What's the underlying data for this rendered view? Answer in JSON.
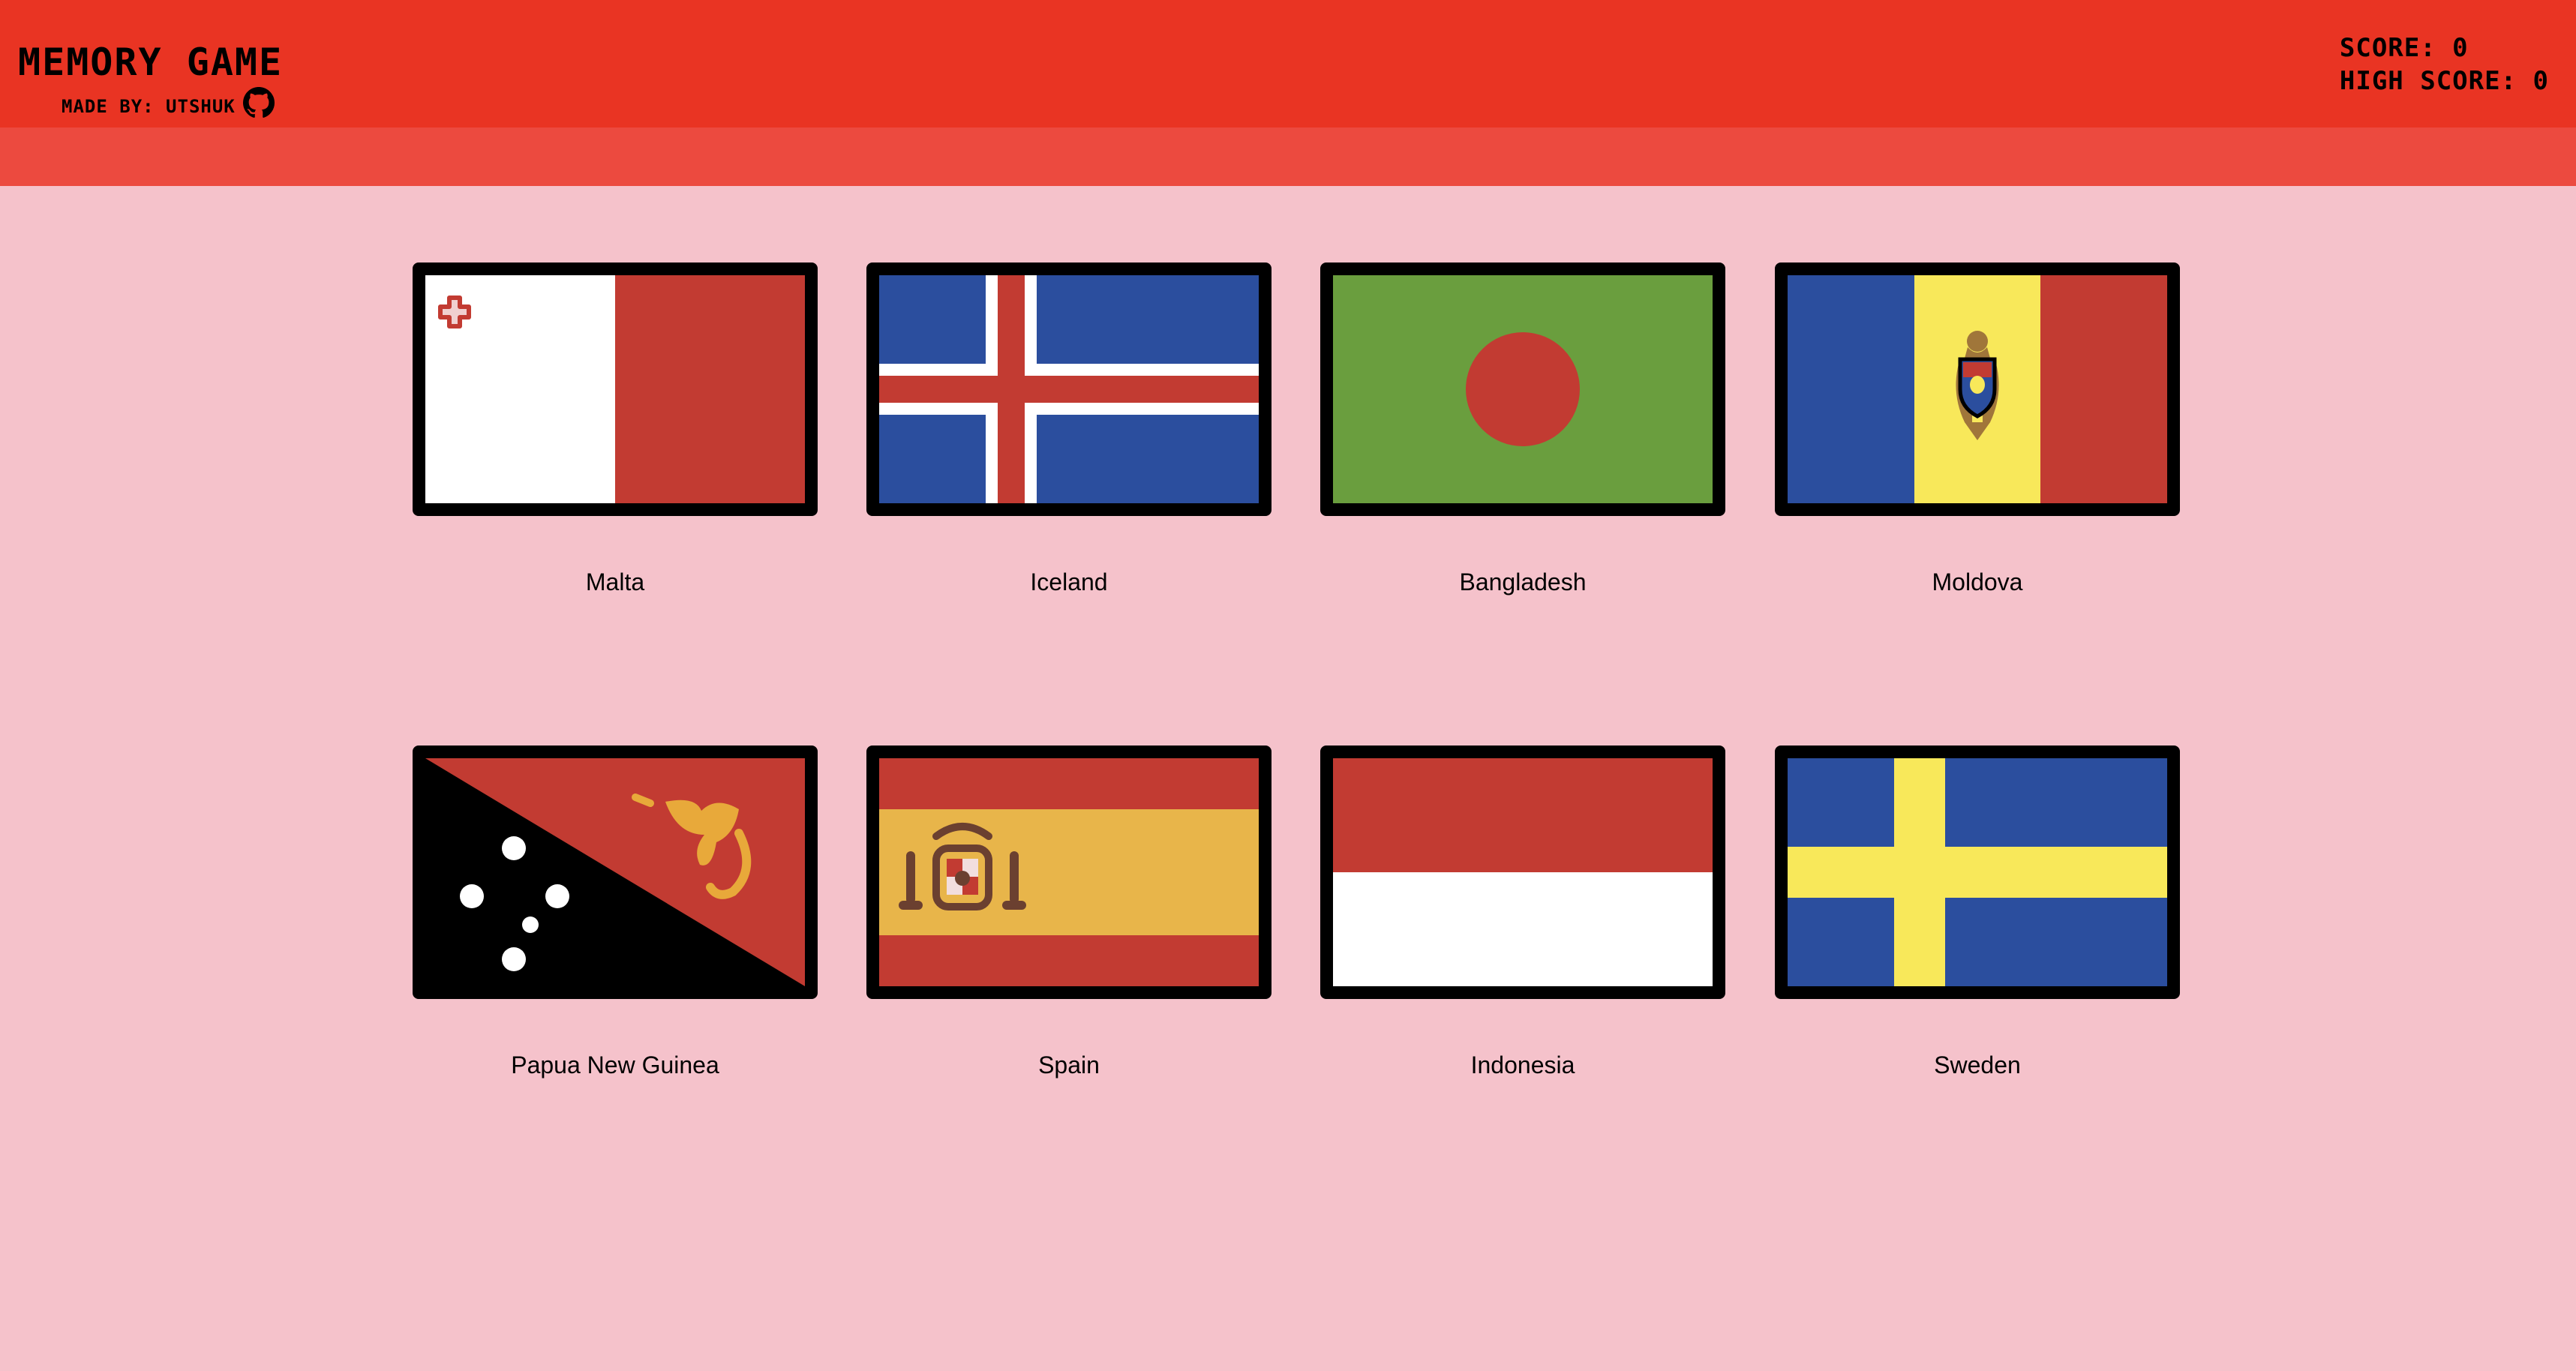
{
  "header": {
    "title": "MEMORY GAME",
    "credit": "MADE BY: UTSHUK",
    "github_icon": "github-icon",
    "score_text": "SCORE: 0",
    "high_score_text": "HIGH SCORE: 0"
  },
  "colors": {
    "header": "#e93423",
    "subbar": "#ec4a3f",
    "background": "#f5c2cb"
  },
  "cards": [
    {
      "name": "Malta"
    },
    {
      "name": "Iceland"
    },
    {
      "name": "Bangladesh"
    },
    {
      "name": "Moldova"
    },
    {
      "name": "Papua New Guinea"
    },
    {
      "name": "Spain"
    },
    {
      "name": "Indonesia"
    },
    {
      "name": "Sweden"
    }
  ]
}
